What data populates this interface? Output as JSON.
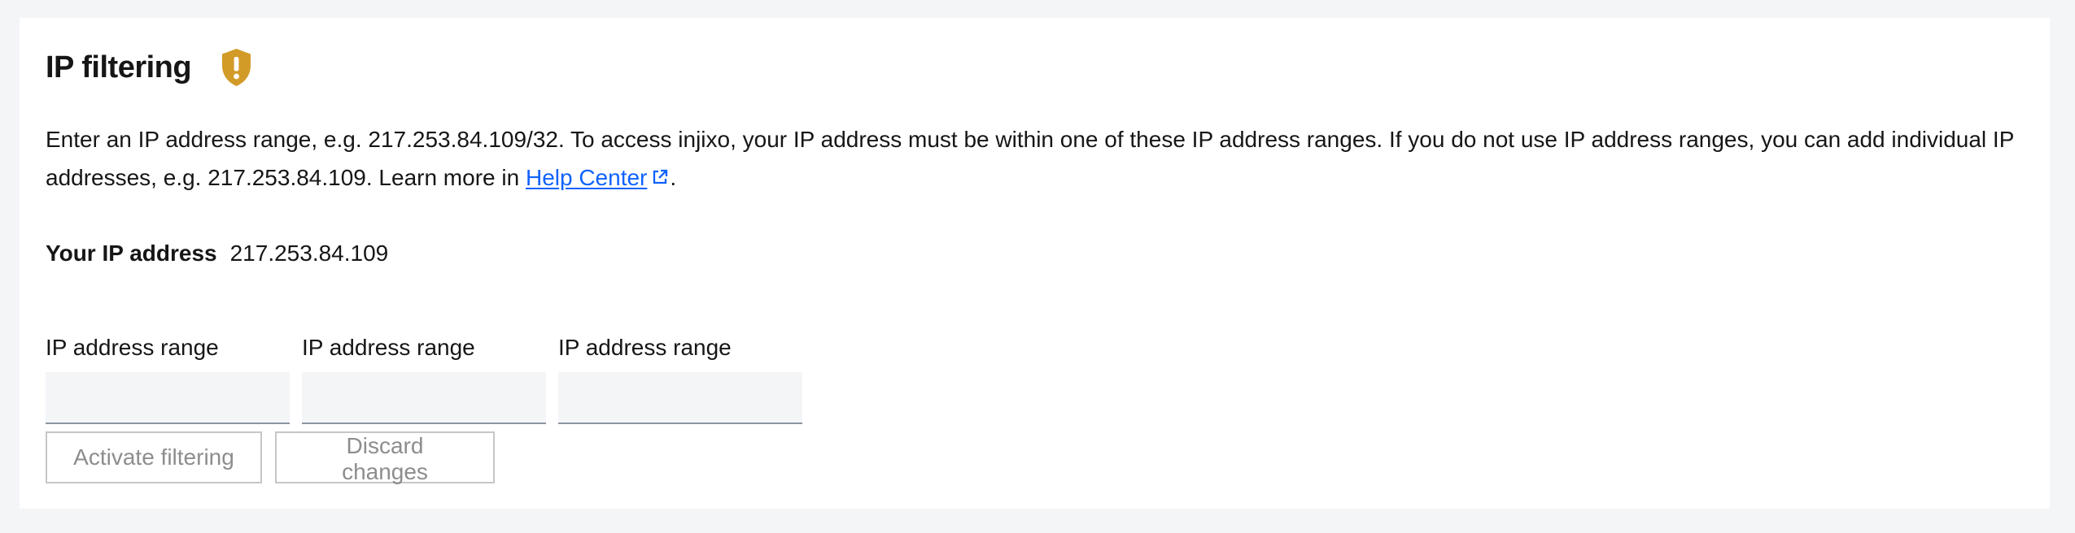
{
  "section": {
    "title": "IP filtering",
    "warning_icon": "shield-warning-icon",
    "accent_color": "#d29b28"
  },
  "description": {
    "text_before_link": "Enter an IP address range, e.g. 217.253.84.109/32. To access injixo, your IP address must be within one of these IP address ranges. If you do not use IP address ranges, you can add individual IP addresses, e.g. 217.253.84.109. Learn more in ",
    "link_text": "Help Center",
    "link_icon": "external-link-icon",
    "text_after_link": ".",
    "link_color": "#0f62fe"
  },
  "your_ip": {
    "label": "Your IP address",
    "value": "217.253.84.109"
  },
  "ranges": [
    {
      "label": "IP address range",
      "value": "",
      "placeholder": ""
    },
    {
      "label": "IP address range",
      "value": "",
      "placeholder": ""
    },
    {
      "label": "IP address range",
      "value": "",
      "placeholder": ""
    }
  ],
  "actions": {
    "activate_label": "Activate filtering",
    "discard_label": "Discard changes",
    "disabled_color": "#8d8d8d"
  }
}
